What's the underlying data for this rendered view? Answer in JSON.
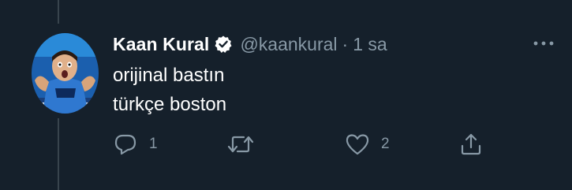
{
  "tweet": {
    "display_name": "Kaan Kural",
    "handle": "@kaankural",
    "separator": "·",
    "time": "1 sa",
    "text_lines": [
      "orijinal bastın",
      "türkçe boston"
    ],
    "verified": true
  },
  "actions": {
    "reply_count": "1",
    "retweet_count": "",
    "like_count": "2"
  },
  "icons": {
    "verified": "verified-badge-icon",
    "more": "more-horizontal-icon",
    "reply": "reply-bubble-icon",
    "retweet": "retweet-icon",
    "like": "heart-icon",
    "share": "share-upload-icon"
  },
  "colors": {
    "background": "#15202b",
    "secondary_text": "#8899a6",
    "primary_text": "#ffffff",
    "thread_line": "#38444d"
  }
}
